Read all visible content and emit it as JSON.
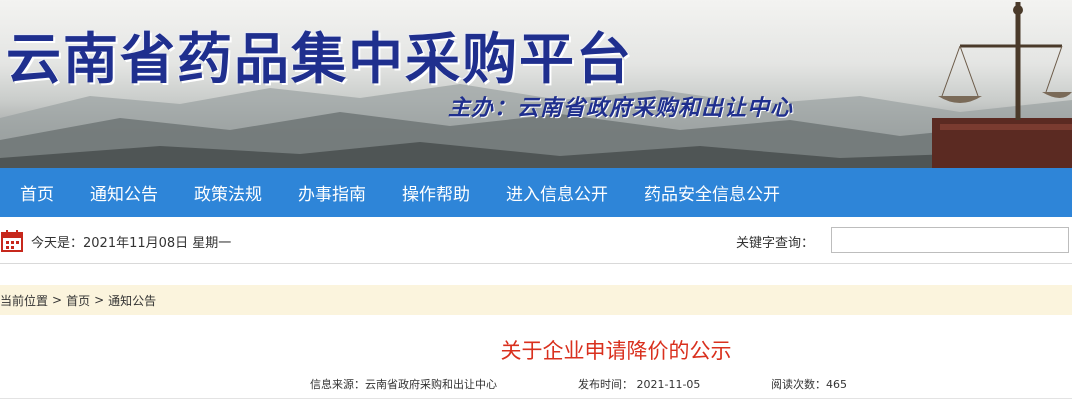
{
  "banner": {
    "title": "云南省药品集中采购平台",
    "sponsor": "主办：云南省政府采购和出让中心"
  },
  "nav": {
    "items": [
      "首页",
      "通知公告",
      "政策法规",
      "办事指南",
      "操作帮助",
      "进入信息公开",
      "药品安全信息公开"
    ]
  },
  "infobar": {
    "today": "今天是：2021年11月08日 星期一",
    "keyword_label": "关键字查询：",
    "keyword_value": ""
  },
  "breadcrumb": {
    "label": "当前位置",
    "sep": ">",
    "items": [
      "首页",
      "通知公告"
    ]
  },
  "article": {
    "title": "关于企业申请降价的公示",
    "source": "信息来源：云南省政府采购和出让中心",
    "published": "发布时间： 2021-11-05",
    "views": "阅读次数：465"
  },
  "colors": {
    "nav_bg": "#2e85d8",
    "title_blue": "#1f2f8e",
    "article_title": "#d9301e",
    "breadcrumb_bg": "#fbf4dd"
  }
}
